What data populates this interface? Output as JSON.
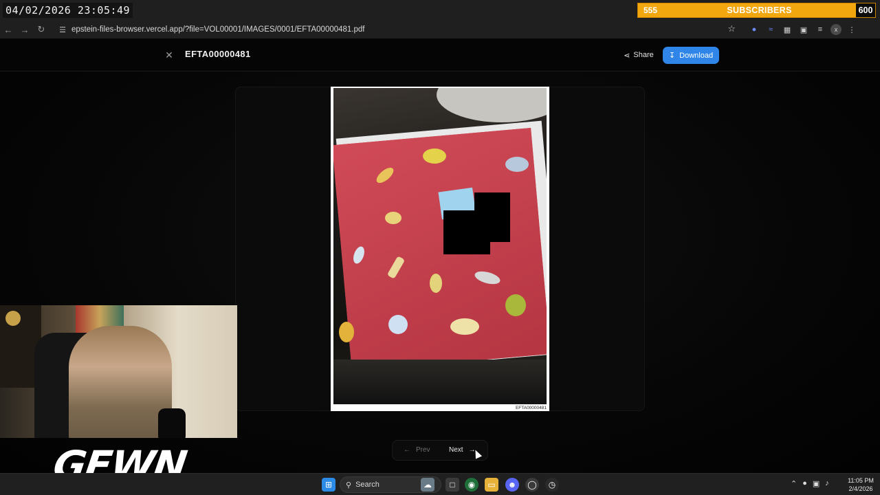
{
  "overlay": {
    "timestamp": "04/02/2026 23:05:49",
    "subscribers": {
      "current": "555",
      "label": "SUBSCRIBERS",
      "goal": "600",
      "progress": 0.925
    },
    "logo_text": "GEWN"
  },
  "browser": {
    "url": "epstein-files-browser.vercel.app/?file=VOL00001/IMAGES/0001/EFTA00000481.pdf",
    "icons": [
      "back-icon",
      "forward-icon",
      "reload-icon",
      "site-info-icon",
      "star-icon",
      "extension-icon",
      "menu-icon"
    ]
  },
  "header": {
    "title": "EFTA00000481",
    "share_label": "Share",
    "download_label": "Download"
  },
  "viewer": {
    "bates_stamp": "EFTA00000481"
  },
  "pager": {
    "prev_label": "Prev",
    "next_label": "Next"
  },
  "taskbar": {
    "search_label": "Search",
    "time": "11:05 PM",
    "date": "2/4/2026"
  },
  "colors": {
    "accent": "#2f86e8",
    "subscriber_bar": "#f3a70e",
    "background": "#000000"
  }
}
